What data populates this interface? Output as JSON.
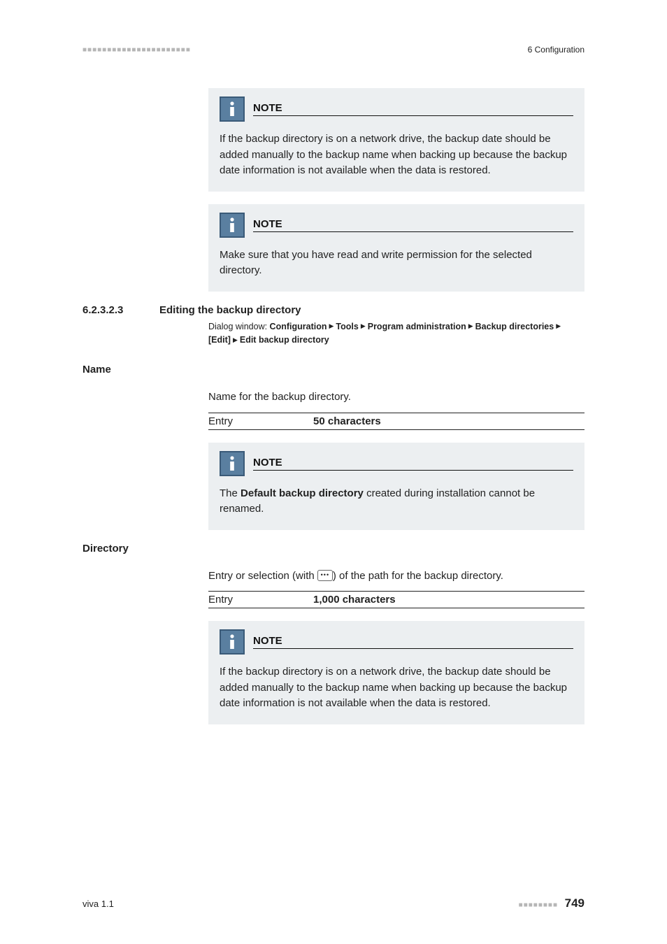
{
  "header": {
    "dashes": "■■■■■■■■■■■■■■■■■■■■■■",
    "right": "6 Configuration"
  },
  "note1": {
    "title": "NOTE",
    "body": "If the backup directory is on a network drive, the backup date should be added manually to the backup name when backing up because the backup date information is not available when the data is restored."
  },
  "note2": {
    "title": "NOTE",
    "body": "Make sure that you have read and write permission for the selected directory."
  },
  "section": {
    "num": "6.2.3.2.3",
    "title": "Editing the backup directory"
  },
  "breadcrumb": {
    "lead": "Dialog window: ",
    "c1": "Configuration",
    "c2": "Tools",
    "c3": "Program administration",
    "c4": "Backup directories",
    "c5": "[Edit]",
    "c6": "Edit backup directory"
  },
  "name": {
    "label": "Name",
    "desc": "Name for the backup directory.",
    "entry_label": "Entry",
    "entry_value": "50 characters"
  },
  "note3": {
    "title": "NOTE",
    "body_pre": "The ",
    "body_bold": "Default backup directory",
    "body_post": " created during installation cannot be renamed."
  },
  "directory": {
    "label": "Directory",
    "desc_pre": "Entry or selection (with ",
    "desc_post": ") of the path for the backup directory.",
    "entry_label": "Entry",
    "entry_value": "1,000 characters"
  },
  "note4": {
    "title": "NOTE",
    "body": "If the backup directory is on a network drive, the backup date should be added manually to the backup name when backing up because the backup date information is not available when the data is restored."
  },
  "footer": {
    "left": "viva 1.1",
    "dashes": "■■■■■■■■",
    "page": "749"
  }
}
